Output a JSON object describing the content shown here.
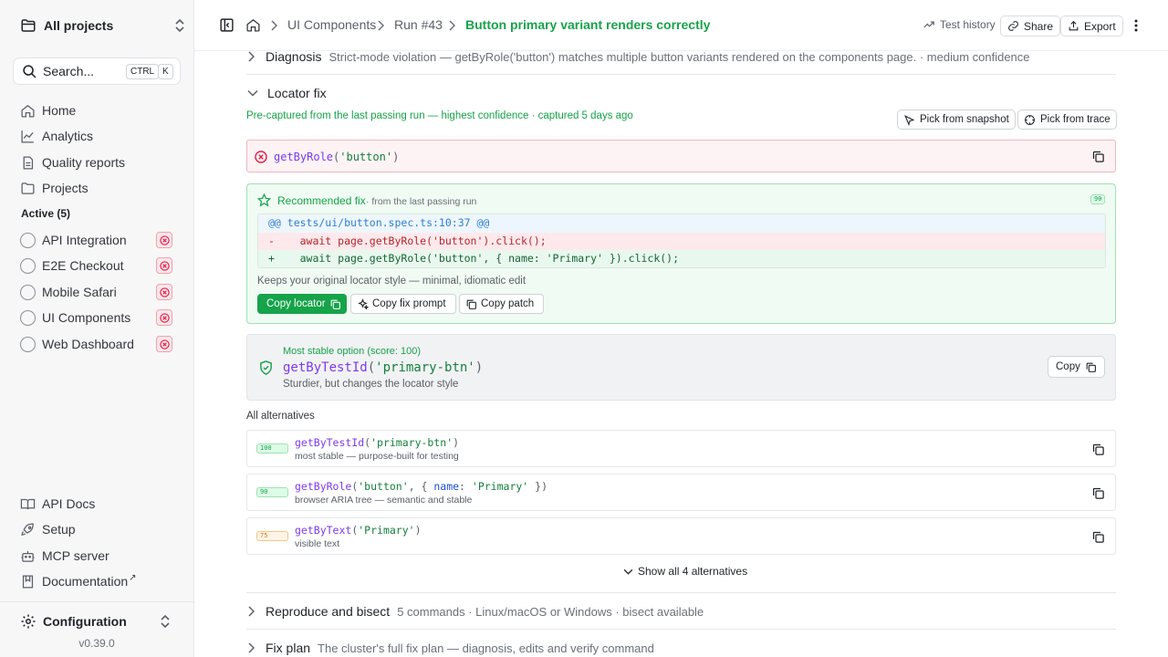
{
  "sidebar": {
    "project_switcher": "All projects",
    "search": {
      "label": "Search...",
      "kbd_ctrl": "CTRL",
      "kbd_k": "K"
    },
    "nav": [
      {
        "label": "Home",
        "icon": "home-icon"
      },
      {
        "label": "Analytics",
        "icon": "chart-line-icon"
      },
      {
        "label": "Quality reports",
        "icon": "document-icon"
      },
      {
        "label": "Projects",
        "icon": "folder-icon"
      }
    ],
    "active_title": "Active (5)",
    "projects": [
      {
        "label": "API Integration"
      },
      {
        "label": "E2E Checkout"
      },
      {
        "label": "Mobile Safari"
      },
      {
        "label": "UI Components"
      },
      {
        "label": "Web Dashboard"
      }
    ],
    "bottom_nav": [
      {
        "label": "API Docs",
        "icon": "book-icon"
      },
      {
        "label": "Setup",
        "icon": "rocket-icon"
      },
      {
        "label": "MCP server",
        "icon": "bot-icon"
      },
      {
        "label": "Documentation",
        "icon": "bookmark-icon",
        "suffix": "↗"
      }
    ],
    "configuration": "Configuration",
    "version": "v0.39.0"
  },
  "header": {
    "breadcrumbs": [
      "UI Components",
      "Run #43",
      "Button primary variant renders correctly"
    ],
    "test_history": "Test history",
    "share": "Share",
    "export": "Export"
  },
  "diagnosis": {
    "title": "Diagnosis",
    "text": "Strict-mode violation — getByRole('button') matches multiple button variants rendered on the components page. · medium confidence"
  },
  "locator_fix": {
    "title": "Locator fix",
    "precaptured": "Pre-captured from the last passing run — highest confidence · captured 5 days ago",
    "pick_snapshot": "Pick from snapshot",
    "pick_trace": "Pick from trace",
    "broken": {
      "fn": "getByRole",
      "open": "(",
      "arg": "'button'",
      "close": ")"
    },
    "recommended": {
      "title": "Recommended fix",
      "subtitle": "· from the last passing run",
      "score": "90",
      "diff_hunk": "@@ tests/ui/button.spec.ts:10:37 @@",
      "diff_del": "-    await page.getByRole('button').click();",
      "diff_add": "+    await page.getByRole('button', { name: 'Primary' }).click();",
      "note": "Keeps your original locator style — minimal, idiomatic edit",
      "copy_locator": "Copy locator",
      "copy_prompt": "Copy fix prompt",
      "copy_patch": "Copy patch"
    },
    "stable": {
      "label": "Most stable option (score: 100)",
      "fn": "getByTestId",
      "open": "(",
      "arg": "'primary-btn'",
      "close": ")",
      "sub": "Sturdier, but changes the locator style",
      "copy": "Copy"
    },
    "alternatives_title": "All alternatives",
    "alternatives": [
      {
        "score": "100",
        "fn": "getByTestId",
        "open": "(",
        "arg": "'primary-btn'",
        "close": ")",
        "sub": "most stable — purpose-built for testing"
      },
      {
        "score": "90",
        "fn": "getByRole",
        "open": "(",
        "arg": "'button'",
        "mid": ", { ",
        "prop": "name",
        "colon": ": ",
        "arg2": "'Primary'",
        "close": " })",
        "sub": "browser ARIA tree — semantic and stable"
      },
      {
        "score": "75",
        "fn": "getByText",
        "open": "(",
        "arg": "'Primary'",
        "close": ")",
        "sub": "visible text"
      }
    ],
    "show_all": "Show all 4 alternatives"
  },
  "reproduce": {
    "title": "Reproduce and bisect",
    "text": "5 commands · Linux/macOS or Windows · bisect available"
  },
  "fix_plan": {
    "title": "Fix plan",
    "text": "The cluster's full fix plan — diagnosis, edits and verify command"
  },
  "colors": {
    "accent": "#16a34a",
    "danger": "#e11d48",
    "warning": "#d97706"
  }
}
